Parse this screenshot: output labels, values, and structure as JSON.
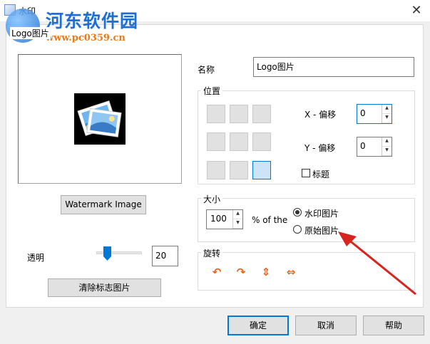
{
  "window": {
    "title": "水印"
  },
  "watermark": {
    "site_name": "河东软件园",
    "site_url": "www.pc0359.cn"
  },
  "tab": {
    "label": "Logo图片"
  },
  "left": {
    "watermark_button": "Watermark Image",
    "transparency_label": "透明",
    "transparency_value": "20",
    "transparency_level": 0.2,
    "clear_button": "清除标志图片"
  },
  "name": {
    "label": "名称",
    "value": "Logo图片"
  },
  "position": {
    "group_label": "位置",
    "x_label": "X - 偏移",
    "x_value": "0",
    "y_label": "Y - 偏移",
    "y_value": "0",
    "title_checkbox": "标题",
    "selected_cell": "bottom-right"
  },
  "size": {
    "group_label": "大小",
    "value": "100",
    "unit": "% of the",
    "option_watermark": "水印图片",
    "option_original": "原始图片",
    "selected": "option_watermark"
  },
  "rotation": {
    "group_label": "旋转",
    "icons": [
      "rotate-left-icon",
      "rotate-right-icon",
      "flip-vertical-icon",
      "flip-horizontal-icon"
    ]
  },
  "footer": {
    "ok": "确定",
    "cancel": "取消",
    "help": "帮助"
  },
  "colors": {
    "accent": "#0078d7",
    "rotate_icon": "#e8621c",
    "annotation_arrow": "#d8231f"
  }
}
